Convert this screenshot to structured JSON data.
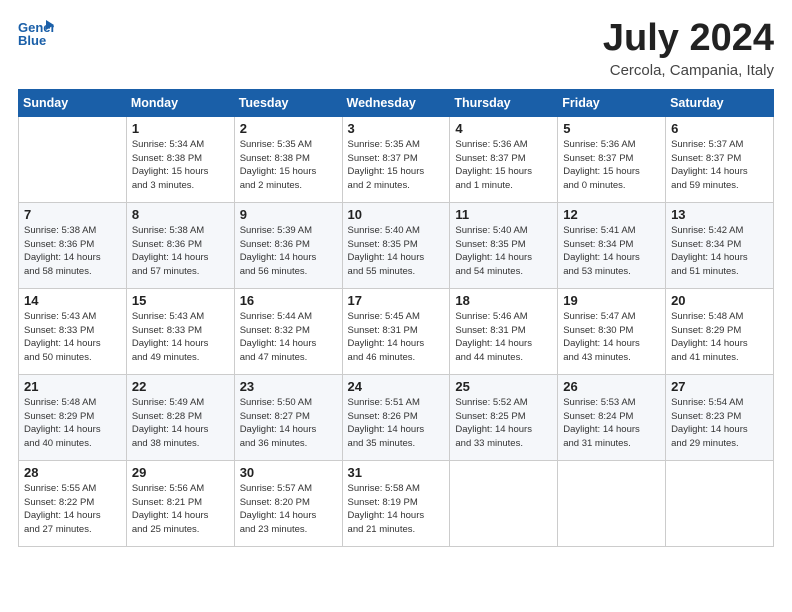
{
  "header": {
    "logo_line1": "General",
    "logo_line2": "Blue",
    "month": "July 2024",
    "location": "Cercola, Campania, Italy"
  },
  "weekdays": [
    "Sunday",
    "Monday",
    "Tuesday",
    "Wednesday",
    "Thursday",
    "Friday",
    "Saturday"
  ],
  "weeks": [
    [
      {
        "day": "",
        "info": ""
      },
      {
        "day": "1",
        "info": "Sunrise: 5:34 AM\nSunset: 8:38 PM\nDaylight: 15 hours\nand 3 minutes."
      },
      {
        "day": "2",
        "info": "Sunrise: 5:35 AM\nSunset: 8:38 PM\nDaylight: 15 hours\nand 2 minutes."
      },
      {
        "day": "3",
        "info": "Sunrise: 5:35 AM\nSunset: 8:37 PM\nDaylight: 15 hours\nand 2 minutes."
      },
      {
        "day": "4",
        "info": "Sunrise: 5:36 AM\nSunset: 8:37 PM\nDaylight: 15 hours\nand 1 minute."
      },
      {
        "day": "5",
        "info": "Sunrise: 5:36 AM\nSunset: 8:37 PM\nDaylight: 15 hours\nand 0 minutes."
      },
      {
        "day": "6",
        "info": "Sunrise: 5:37 AM\nSunset: 8:37 PM\nDaylight: 14 hours\nand 59 minutes."
      }
    ],
    [
      {
        "day": "7",
        "info": "Sunrise: 5:38 AM\nSunset: 8:36 PM\nDaylight: 14 hours\nand 58 minutes."
      },
      {
        "day": "8",
        "info": "Sunrise: 5:38 AM\nSunset: 8:36 PM\nDaylight: 14 hours\nand 57 minutes."
      },
      {
        "day": "9",
        "info": "Sunrise: 5:39 AM\nSunset: 8:36 PM\nDaylight: 14 hours\nand 56 minutes."
      },
      {
        "day": "10",
        "info": "Sunrise: 5:40 AM\nSunset: 8:35 PM\nDaylight: 14 hours\nand 55 minutes."
      },
      {
        "day": "11",
        "info": "Sunrise: 5:40 AM\nSunset: 8:35 PM\nDaylight: 14 hours\nand 54 minutes."
      },
      {
        "day": "12",
        "info": "Sunrise: 5:41 AM\nSunset: 8:34 PM\nDaylight: 14 hours\nand 53 minutes."
      },
      {
        "day": "13",
        "info": "Sunrise: 5:42 AM\nSunset: 8:34 PM\nDaylight: 14 hours\nand 51 minutes."
      }
    ],
    [
      {
        "day": "14",
        "info": "Sunrise: 5:43 AM\nSunset: 8:33 PM\nDaylight: 14 hours\nand 50 minutes."
      },
      {
        "day": "15",
        "info": "Sunrise: 5:43 AM\nSunset: 8:33 PM\nDaylight: 14 hours\nand 49 minutes."
      },
      {
        "day": "16",
        "info": "Sunrise: 5:44 AM\nSunset: 8:32 PM\nDaylight: 14 hours\nand 47 minutes."
      },
      {
        "day": "17",
        "info": "Sunrise: 5:45 AM\nSunset: 8:31 PM\nDaylight: 14 hours\nand 46 minutes."
      },
      {
        "day": "18",
        "info": "Sunrise: 5:46 AM\nSunset: 8:31 PM\nDaylight: 14 hours\nand 44 minutes."
      },
      {
        "day": "19",
        "info": "Sunrise: 5:47 AM\nSunset: 8:30 PM\nDaylight: 14 hours\nand 43 minutes."
      },
      {
        "day": "20",
        "info": "Sunrise: 5:48 AM\nSunset: 8:29 PM\nDaylight: 14 hours\nand 41 minutes."
      }
    ],
    [
      {
        "day": "21",
        "info": "Sunrise: 5:48 AM\nSunset: 8:29 PM\nDaylight: 14 hours\nand 40 minutes."
      },
      {
        "day": "22",
        "info": "Sunrise: 5:49 AM\nSunset: 8:28 PM\nDaylight: 14 hours\nand 38 minutes."
      },
      {
        "day": "23",
        "info": "Sunrise: 5:50 AM\nSunset: 8:27 PM\nDaylight: 14 hours\nand 36 minutes."
      },
      {
        "day": "24",
        "info": "Sunrise: 5:51 AM\nSunset: 8:26 PM\nDaylight: 14 hours\nand 35 minutes."
      },
      {
        "day": "25",
        "info": "Sunrise: 5:52 AM\nSunset: 8:25 PM\nDaylight: 14 hours\nand 33 minutes."
      },
      {
        "day": "26",
        "info": "Sunrise: 5:53 AM\nSunset: 8:24 PM\nDaylight: 14 hours\nand 31 minutes."
      },
      {
        "day": "27",
        "info": "Sunrise: 5:54 AM\nSunset: 8:23 PM\nDaylight: 14 hours\nand 29 minutes."
      }
    ],
    [
      {
        "day": "28",
        "info": "Sunrise: 5:55 AM\nSunset: 8:22 PM\nDaylight: 14 hours\nand 27 minutes."
      },
      {
        "day": "29",
        "info": "Sunrise: 5:56 AM\nSunset: 8:21 PM\nDaylight: 14 hours\nand 25 minutes."
      },
      {
        "day": "30",
        "info": "Sunrise: 5:57 AM\nSunset: 8:20 PM\nDaylight: 14 hours\nand 23 minutes."
      },
      {
        "day": "31",
        "info": "Sunrise: 5:58 AM\nSunset: 8:19 PM\nDaylight: 14 hours\nand 21 minutes."
      },
      {
        "day": "",
        "info": ""
      },
      {
        "day": "",
        "info": ""
      },
      {
        "day": "",
        "info": ""
      }
    ]
  ]
}
